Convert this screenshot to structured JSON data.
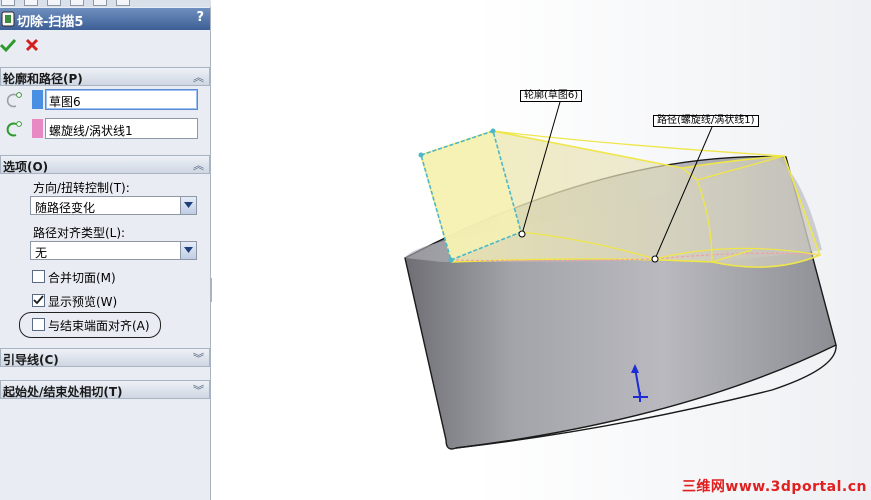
{
  "feature": {
    "title": "切除-扫描5",
    "help": "?"
  },
  "profile_path": {
    "header": "轮廓和路径(P)",
    "profile_value": "草图6",
    "path_value": "螺旋线/涡状线1",
    "profile_color": "#4a90e2",
    "path_color": "#e78ac3"
  },
  "options": {
    "header": "选项(O)",
    "orientation_label": "方向/扭转控制(T):",
    "orientation_value": "随路径变化",
    "alignment_label": "路径对齐类型(L):",
    "alignment_value": "无",
    "merge_faces_label": "合并切面(M)",
    "merge_faces_checked": false,
    "show_preview_label": "显示预览(W)",
    "show_preview_checked": true,
    "align_end_faces_label": "与结束端面对齐(A)",
    "align_end_faces_checked": false
  },
  "guides": {
    "header": "引导线(C)"
  },
  "tangency": {
    "header": "起始处/结束处相切(T)"
  },
  "viewport": {
    "profile_callout": "轮廓(草图6)",
    "path_callout": "路径(螺旋线/涡状线1)",
    "preview_color": "#f5ee6a",
    "body_color": "#9a9aa0"
  },
  "watermark": "三维网www.3dportal.cn"
}
